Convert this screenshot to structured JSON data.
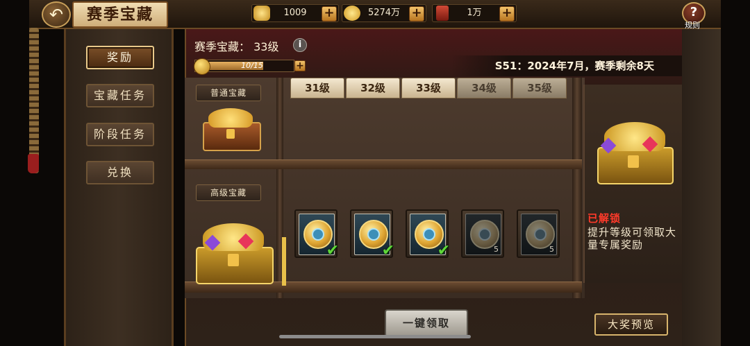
{
  "header": {
    "title": "赛季宝藏",
    "resources": [
      {
        "name": "yuanbao",
        "value": "1009",
        "icon": "gold-ingot-icon",
        "color": "#e9c15a"
      },
      {
        "name": "coins",
        "value": "5274万",
        "icon": "gold-coin-icon",
        "color": "#e8b93c"
      },
      {
        "name": "token",
        "value": "1万",
        "icon": "red-ticket-icon",
        "color": "#c43a2b"
      }
    ],
    "help_label": "规则"
  },
  "sidebar": {
    "items": [
      {
        "label": "奖励",
        "active": true
      },
      {
        "label": "宝藏任务",
        "active": false
      },
      {
        "label": "阶段任务",
        "active": false
      },
      {
        "label": "兑换",
        "active": false
      }
    ]
  },
  "treasure": {
    "title": "赛季宝藏：",
    "level": "33级",
    "progress_text": "10/15",
    "progress_fraction": 0.6667
  },
  "season_text": "S51：2024年7月，赛季剩余8天",
  "chest_labels": {
    "normal": "普通宝藏",
    "advanced": "高级宝藏"
  },
  "level_tabs": [
    {
      "label": "31级",
      "locked": false
    },
    {
      "label": "32级",
      "locked": false
    },
    {
      "label": "33级",
      "locked": false
    },
    {
      "label": "34级",
      "locked": true
    },
    {
      "label": "35级",
      "locked": true
    }
  ],
  "rewards": [
    {
      "claimed": true,
      "count": ""
    },
    {
      "claimed": true,
      "count": ""
    },
    {
      "claimed": true,
      "count": ""
    },
    {
      "claimed": false,
      "count": "5"
    },
    {
      "claimed": false,
      "count": "5"
    }
  ],
  "preview": {
    "status": "已解锁",
    "description": "提升等级可领取大量专属奖励"
  },
  "buttons": {
    "claim_all": "一键领取",
    "grand_preview": "大奖预览"
  }
}
